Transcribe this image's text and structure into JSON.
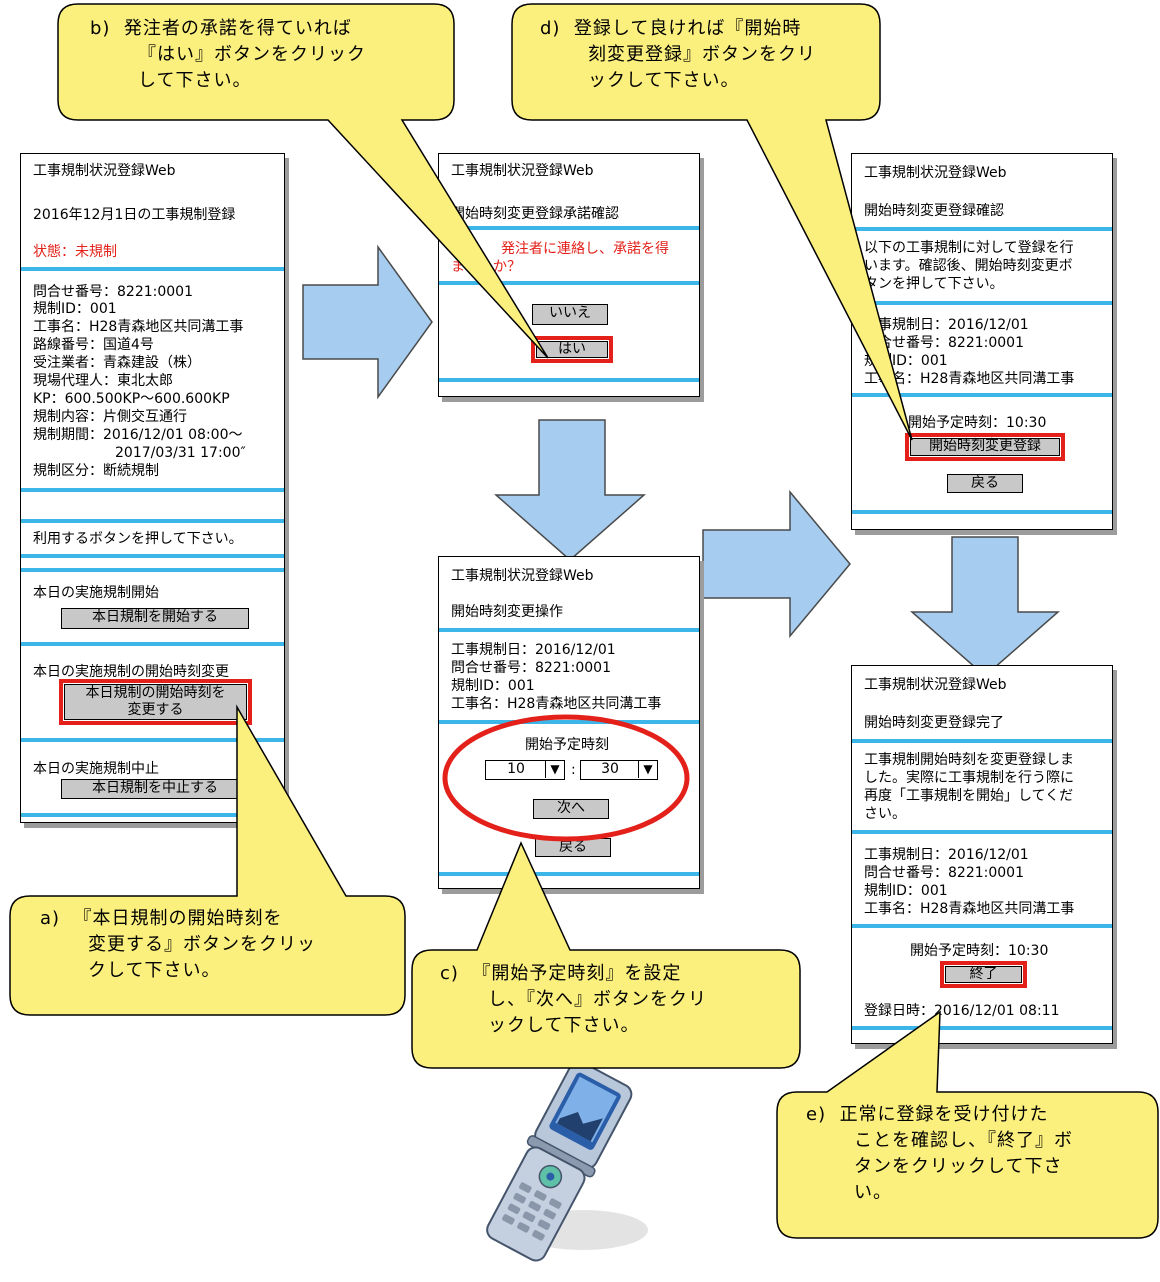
{
  "colors": {
    "arrow_fill": "#a6cdf0",
    "callout_fill": "#fbf07e",
    "separator": "#3cb6e8",
    "highlight_red": "#e32019",
    "button_gray": "#c8c8c8"
  },
  "screen1": {
    "app_title": "工事規制状況登録Web",
    "date_title": "2016年12月1日の工事規制登録",
    "status": "状態：未規制",
    "details": [
      "問合せ番号：8221:0001",
      "規制ID：001",
      "工事名：H28青森地区共同溝工事",
      "路線番号：国道4号",
      "受注業者：青森建設（株）",
      "現場代理人：東北太郎",
      "KP：600.500KP～600.600KP",
      "規制内容：片側交互通行",
      "規制期間：2016/12/01 08:00～",
      "2017/03/31 17:00″",
      "規制区分：断続規制"
    ],
    "prompt": "利用するボタンを押して下さい。",
    "start_label": "本日の実施規制開始",
    "start_button": "本日規制を開始する",
    "change_label": "本日の実施規制の開始時刻変更",
    "change_button_l1": "本日規制の開始時刻を",
    "change_button_l2": "変更する",
    "stop_label": "本日の実施規制中止",
    "stop_button": "本日規制を中止する"
  },
  "screen2": {
    "app_title": "工事規制状況登録Web",
    "heading": "開始時刻変更登録承諾確認",
    "question_l1": "発注者に連絡し、承諾を得",
    "question_l2": "ましたか？",
    "no_button": "いいえ",
    "yes_button": "はい"
  },
  "screen3": {
    "app_title": "工事規制状況登録Web",
    "heading": "開始時刻変更操作",
    "details": [
      "工事規制日：2016/12/01",
      "問合せ番号：8221:0001",
      "規制ID：001",
      "工事名：H28青森地区共同溝工事"
    ],
    "time_label": "開始予定時刻",
    "hour_value": "10",
    "minute_value": "30",
    "colon": ":",
    "next_button": "次へ",
    "back_button": "戻る"
  },
  "screen4": {
    "app_title": "工事規制状況登録Web",
    "heading": "開始時刻変更登録確認",
    "message": [
      "以下の工事規制に対して登録を行",
      "います。確認後、開始時刻変更ボ",
      "タンを押して下さい。"
    ],
    "details": [
      "工事規制日：2016/12/01",
      "問合せ番号：8221:0001",
      "規制ID：001",
      "工事名：H28青森地区共同溝工事"
    ],
    "time_text": "開始予定時刻：10:30",
    "register_button": "開始時刻変更登録",
    "back_button": "戻る"
  },
  "screen5": {
    "app_title": "工事規制状況登録Web",
    "heading": "開始時刻変更登録完了",
    "message": [
      "工事規制開始時刻を変更登録しま",
      "した。実際に工事規制を行う際に",
      "再度「工事規制を開始」してくだ",
      "さい。"
    ],
    "details": [
      "工事規制日：2016/12/01",
      "問合せ番号：8221:0001",
      "規制ID：001",
      "工事名：H28青森地区共同溝工事"
    ],
    "time_text": "開始予定時刻：10:30",
    "end_button": "終了",
    "registered_at": "登録日時：2016/12/01 08:11"
  },
  "callouts": {
    "a": {
      "marker": "a)",
      "lines": [
        "『本日規制の開始時刻を",
        "変更する』ボタンをクリッ",
        "クして下さい。"
      ]
    },
    "b": {
      "marker": "b)",
      "lines": [
        "発注者の承諾を得ていれば",
        "『はい』ボタンをクリック",
        "して下さい。"
      ]
    },
    "c": {
      "marker": "c)",
      "lines": [
        "『開始予定時刻』を設定",
        "し、『次へ』ボタンをクリ",
        "ックして下さい。"
      ]
    },
    "d": {
      "marker": "d)",
      "lines": [
        "登録して良ければ『開始時",
        "刻変更登録』ボタンをクリ",
        "ックして下さい。"
      ]
    },
    "e": {
      "marker": "e)",
      "lines": [
        "正常に登録を受け付けた",
        "ことを確認し、『終了』ボ",
        "タンをクリックして下さ",
        "い。"
      ]
    }
  },
  "icons": {
    "phone": "flip-phone-icon"
  }
}
